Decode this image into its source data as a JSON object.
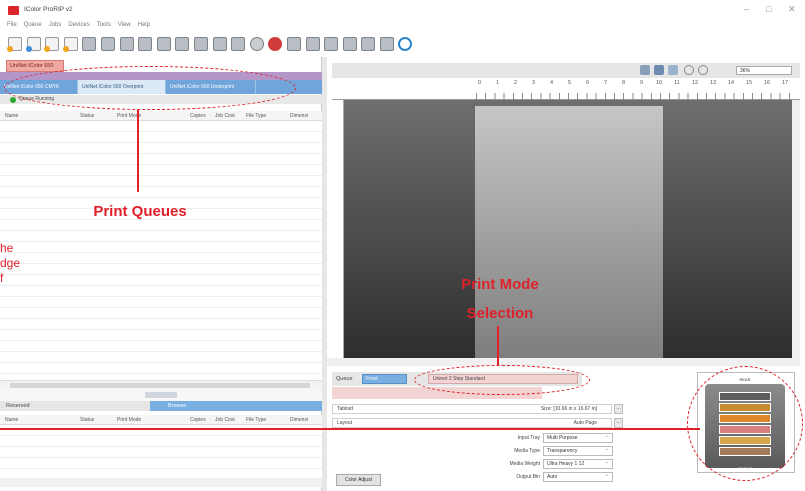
{
  "window": {
    "title": "IColor ProRIP v2"
  },
  "menu": [
    "File",
    "Queue",
    "Jobs",
    "Devices",
    "Tools",
    "View",
    "Help"
  ],
  "printer_tab": "UniNet iColor 650",
  "queue_tabs": [
    "UniNet iColor 650 CMYK",
    "UniNet iColor 650 Overprint",
    "UniNet iColor 650 Underprint"
  ],
  "queue_status": "Queue Running",
  "job_columns": [
    "Name",
    "Status",
    "Print Mode",
    "Copies",
    "Job Cost",
    "File Type",
    "Dimensi"
  ],
  "reserved": {
    "tab": "Reserved",
    "browse_tab": "Browse"
  },
  "preview": {
    "zoom": "36%",
    "ruler_numbers": [
      "0",
      "1",
      "2",
      "3",
      "4",
      "5",
      "6",
      "7",
      "8",
      "9",
      "10",
      "11",
      "12",
      "13",
      "14",
      "15",
      "16",
      "17"
    ]
  },
  "settings": {
    "queue_label": "Queue",
    "queue_value": "Front",
    "print_mode": "Uninet 2 Step Standard",
    "paper": "Tabloid",
    "size": "Size: [10.66 in x 16.67 in]",
    "layout": "Layout",
    "layout_value": "Auto Page",
    "input_tray_label": "Input Tray",
    "input_tray": "Multi Purpose",
    "media_type_label": "Media Type",
    "media_type": "Transparency",
    "media_weight_label": "Media Weight",
    "media_weight": "Ultra Heavy 1 12",
    "output_bin_label": "Output Bin",
    "output_bin": "Auto",
    "color_adjust": "Color Adjust"
  },
  "printer_graphic": {
    "rear": "REAR",
    "front": "FRONT"
  },
  "annotations": {
    "print_queues": "Print Queues",
    "print_mode_selection": [
      "Print Mode",
      "Selection"
    ],
    "cut_text": [
      "he",
      "dge",
      "f"
    ]
  },
  "colors": {
    "callout_red": "#e0202a",
    "queue_blue": "#6fa5db",
    "printer_purple": "#b596c8"
  }
}
